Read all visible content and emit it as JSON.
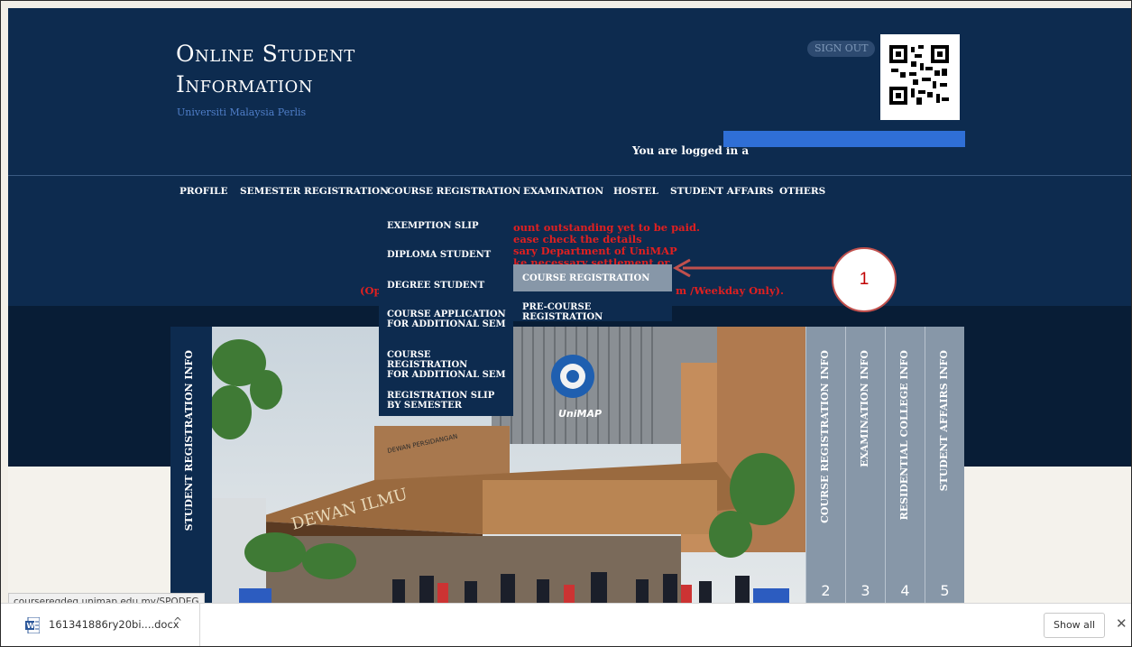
{
  "header": {
    "title_line1": "Online Student",
    "title_line2": "Information",
    "subtitle": "Universiti Malaysia Perlis",
    "sign_out": "SIGN OUT",
    "logged_in": "You are logged in a"
  },
  "nav": {
    "items": [
      "PROFILE",
      "SEMESTER REGISTRATION",
      "COURSE REGISTRATION",
      "EXAMINATION",
      "HOSTEL",
      "STUDENT AFFAIRS",
      "OTHERS"
    ]
  },
  "warning": {
    "line1": "ount outstanding yet to be paid.",
    "line2": "ease check the details",
    "line3": "sary Department of UniMAP",
    "line4": "ke necessary settlement or",
    "line5_left": "(Op",
    "line5_right": "m /Weekday Only)."
  },
  "dropdown": {
    "items": [
      "EXEMPTION SLIP",
      "DIPLOMA STUDENT",
      "DEGREE STUDENT",
      "COURSE APPLICATION FOR ADDITIONAL SEM",
      "COURSE REGISTRATION FOR ADDITIONAL SEM",
      "REGISTRATION SLIP BY SEMESTER"
    ],
    "item4_l1": "COURSE APPLICATION",
    "item4_l2": "FOR ADDITIONAL SEM",
    "item5_l1": "COURSE REGISTRATION",
    "item5_l2": "FOR ADDITIONAL SEM",
    "item6_l1": "REGISTRATION SLIP",
    "item6_l2": "BY SEMESTER"
  },
  "submenu": {
    "items": [
      "COURSE REGISTRATION",
      "PRE-COURSE REGISTRATION"
    ]
  },
  "side_tabs": {
    "left": "STUDENT REGISTRATION INFO",
    "right": [
      {
        "label": "COURSE REGISTRATION INFO",
        "num": "2"
      },
      {
        "label": "EXAMINATION INFO",
        "num": "3"
      },
      {
        "label": "RESIDENTIAL COLLEGE INFO",
        "num": "4"
      },
      {
        "label": "STUDENT AFFAIRS INFO",
        "num": "5"
      }
    ]
  },
  "photo": {
    "sign1": "DEWAN PERSIDANGAN",
    "sign2": "DEWAN ILMU",
    "logo": "UniMAP"
  },
  "callout": {
    "number": "1"
  },
  "status_url": "courseregdeg.unimap.edu.my/SPODEG",
  "downloads": {
    "file_name": "161341886ry20bi....docx",
    "show_all": "Show all"
  },
  "colors": {
    "navy": "#0d2b4f",
    "warning_red": "#e02020",
    "highlight_gray": "#8797a8",
    "callout_border": "#c0504d",
    "redaction_blue": "#2f6fd6"
  }
}
